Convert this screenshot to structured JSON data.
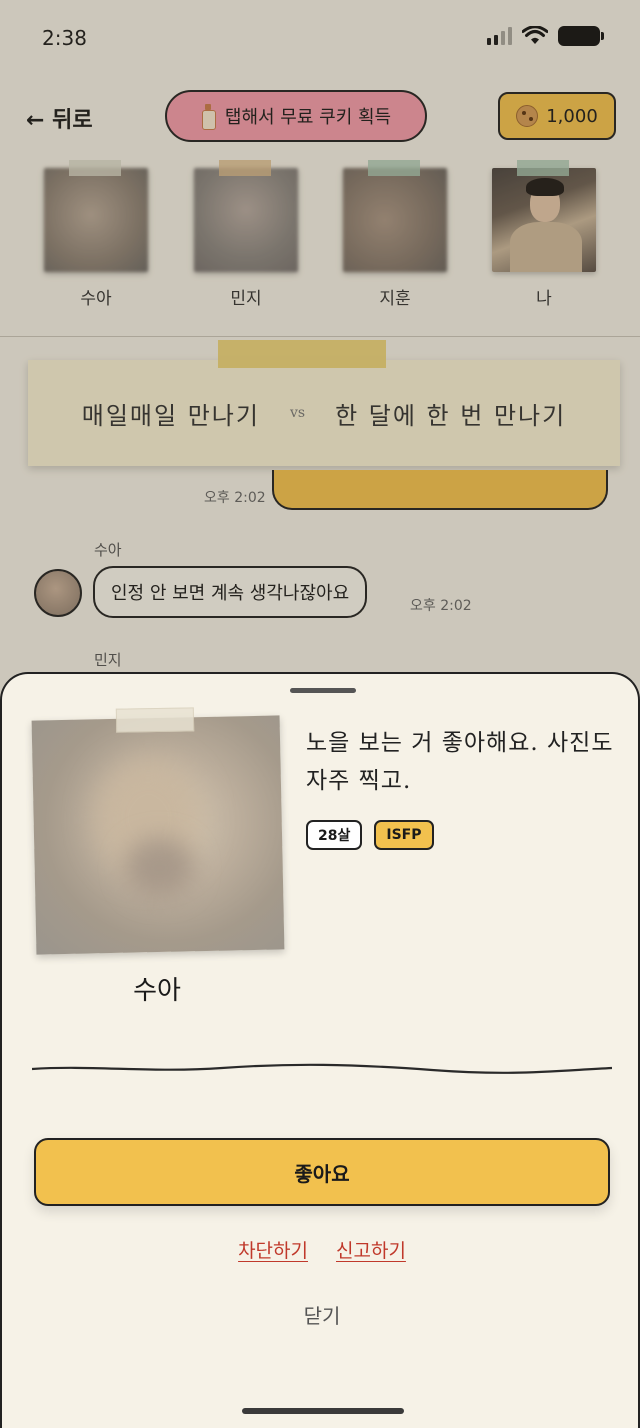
{
  "status_bar": {
    "time": "2:38"
  },
  "header": {
    "back_label": "← 뒤로",
    "free_cookie_label": "탭해서 무료 쿠키 획득",
    "cookie_count": "1,000"
  },
  "members": [
    {
      "name": "수아"
    },
    {
      "name": "민지"
    },
    {
      "name": "지훈"
    },
    {
      "name": "나"
    }
  ],
  "topic": {
    "option_a": "매일매일 만나기",
    "vs": "vs",
    "option_b": "한 달에 한 번 만나기"
  },
  "chat": {
    "my_message_time": "오후 2:02",
    "messages": [
      {
        "sender": "수아",
        "text": "인정 안 보면 계속 생각나잖아요",
        "time": "오후 2:02"
      },
      {
        "sender": "민지"
      }
    ]
  },
  "profile_sheet": {
    "name": "수아",
    "bio": "노을 보는 거 좋아해요. 사진도 자주 찍고.",
    "tags": {
      "age": "28살",
      "mbti": "ISFP"
    },
    "like_label": "좋아요",
    "block_label": "차단하기",
    "report_label": "신고하기",
    "close_label": "닫기"
  },
  "colors": {
    "accent_yellow": "#f2c14e",
    "pink_button": "#f29aa9",
    "danger_red": "#c0392b",
    "paper": "#f6f2e7"
  }
}
